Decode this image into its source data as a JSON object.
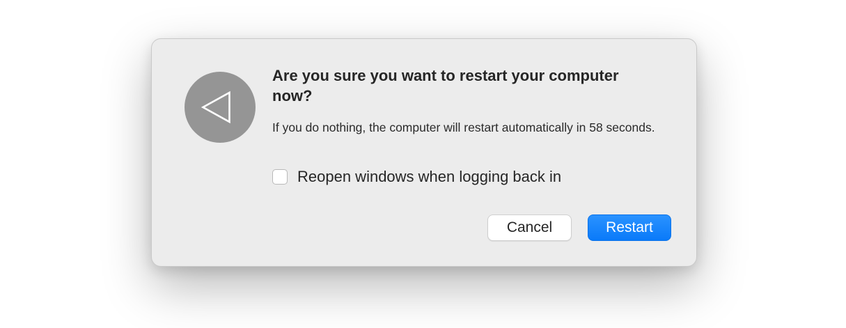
{
  "dialog": {
    "icon": "restart-triangle-icon",
    "title": "Are you sure you want to restart your computer now?",
    "message": "If you do nothing, the computer will restart automatically in 58 seconds.",
    "checkbox": {
      "label": "Reopen windows when logging back in",
      "checked": false
    },
    "buttons": {
      "cancel_label": "Cancel",
      "restart_label": "Restart"
    }
  },
  "colors": {
    "dialog_background": "#ececec",
    "icon_circle": "#959595",
    "primary_button": "#0a7af9",
    "text": "#262626"
  }
}
